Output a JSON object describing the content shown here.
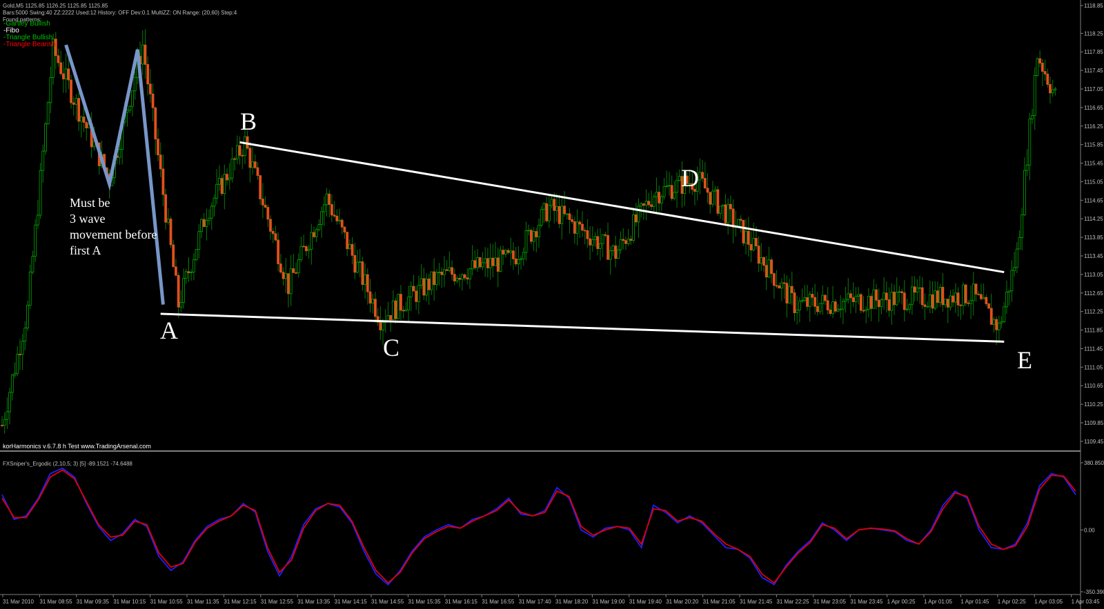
{
  "header": {
    "line1": "Gold,M5  1125.85 1126.25 1125.85 1125.85",
    "line2": "Bars:5000  Swing:40  ZZ:2222  Used:12  History: OFF Dev:0.1  MultiZZ: ON  Range: (20,60)  Step:4",
    "found": "Found patterns:"
  },
  "patterns": [
    {
      "label": "-Gartley Bullish",
      "color": "#00c000"
    },
    {
      "label": "-Fibo",
      "color": "#ffffff"
    },
    {
      "label": "-Triangle Bullish",
      "color": "#00c000"
    },
    {
      "label": "-Triangle Bearish",
      "color": "#ff0000"
    }
  ],
  "annotation": {
    "lines": [
      "Must be",
      "3 wave",
      "movement before",
      "first A"
    ]
  },
  "points": {
    "A": "A",
    "B": "B",
    "C": "C",
    "D": "D",
    "E": "E"
  },
  "watermark": "korHarmonics v.6.7.8 h Test www.TradingArsenal.com",
  "indicator": {
    "title": "FXSniper's_Ergodic (2,10,5; 3) [5] -89.1521 -74.6488"
  },
  "colors": {
    "bull": "#00aa00",
    "bear": "#e0501c",
    "fibo": "#7896c8",
    "line": "#ffffff",
    "ergodic": "#2020ff",
    "signal": "#e00000",
    "axis": "#808080"
  },
  "chart_data": [
    {
      "type": "candlestick",
      "title": "Gold,M5",
      "ylim": [
        1109.3,
        1118.85
      ],
      "y_ticks": [
        "1118.85",
        "1118.25",
        "1117.85",
        "1117.45",
        "1117.05",
        "1116.65",
        "1116.25",
        "1115.85",
        "1115.45",
        "1115.05",
        "1114.65",
        "1114.25",
        "1113.85",
        "1113.45",
        "1113.05",
        "1112.65",
        "1112.25",
        "1111.85",
        "1111.45",
        "1111.05",
        "1110.65",
        "1110.25",
        "1109.85",
        "1109.45"
      ],
      "x_ticks": [
        "31 Mar 2010",
        "31 Mar 08:55",
        "31 Mar 09:35",
        "31 Mar 10:15",
        "31 Mar 10:55",
        "31 Mar 11:35",
        "31 Mar 12:15",
        "31 Mar 12:55",
        "31 Mar 13:35",
        "31 Mar 14:15",
        "31 Mar 14:55",
        "31 Mar 15:35",
        "31 Mar 16:15",
        "31 Mar 16:55",
        "31 Mar 17:40",
        "31 Mar 18:20",
        "31 Mar 19:00",
        "31 Mar 19:40",
        "31 Mar 20:20",
        "31 Mar 21:05",
        "31 Mar 21:45",
        "31 Mar 22:25",
        "31 Mar 23:05",
        "31 Mar 23:45",
        "1 Apr 00:25",
        "1 Apr 01:05",
        "1 Apr 01:45",
        "1 Apr 02:25",
        "1 Apr 03:05",
        "1 Apr 03:45"
      ],
      "path_anchors": [
        {
          "bar": 0,
          "price": 1109.8
        },
        {
          "bar": 10,
          "price": 1112.3
        },
        {
          "bar": 20,
          "price": 1117.9
        },
        {
          "bar": 30,
          "price": 1116.6
        },
        {
          "bar": 42,
          "price": 1115.1
        },
        {
          "bar": 55,
          "price": 1118.0
        },
        {
          "bar": 69,
          "price": 1112.4
        },
        {
          "bar": 80,
          "price": 1114.4
        },
        {
          "bar": 95,
          "price": 1115.9
        },
        {
          "bar": 112,
          "price": 1112.8
        },
        {
          "bar": 127,
          "price": 1114.7
        },
        {
          "bar": 148,
          "price": 1112.1
        },
        {
          "bar": 171,
          "price": 1113.0
        },
        {
          "bar": 200,
          "price": 1113.4
        },
        {
          "bar": 214,
          "price": 1114.5
        },
        {
          "bar": 240,
          "price": 1113.5
        },
        {
          "bar": 255,
          "price": 1114.8
        },
        {
          "bar": 272,
          "price": 1115.1
        },
        {
          "bar": 289,
          "price": 1114.0
        },
        {
          "bar": 310,
          "price": 1112.4
        },
        {
          "bar": 340,
          "price": 1112.5
        },
        {
          "bar": 380,
          "price": 1112.6
        },
        {
          "bar": 390,
          "price": 1111.9
        },
        {
          "bar": 397,
          "price": 1113.5
        },
        {
          "bar": 405,
          "price": 1117.8
        },
        {
          "bar": 412,
          "price": 1116.9
        }
      ],
      "triangle": {
        "A": {
          "bar": 62,
          "price": 1112.2
        },
        "B": {
          "bar": 93,
          "price": 1115.9
        },
        "C": {
          "bar": 148,
          "price": 1112.1
        },
        "D": {
          "bar": 257,
          "price": 1114.9
        },
        "E": {
          "bar": 392,
          "price": 1111.6
        },
        "upper": [
          {
            "bar": 93,
            "price": 1115.9
          },
          {
            "bar": 392,
            "price": 1113.1
          }
        ],
        "lower": [
          {
            "bar": 62,
            "price": 1112.2
          },
          {
            "bar": 392,
            "price": 1111.6
          }
        ]
      },
      "fibo_zigzag": [
        {
          "bar": 25,
          "price": 1118.0
        },
        {
          "bar": 42,
          "price": 1115.0
        },
        {
          "bar": 53,
          "price": 1117.9
        },
        {
          "bar": 63,
          "price": 1112.4
        }
      ]
    },
    {
      "type": "line",
      "title": "FXSniper's_Ergodic (2,10,5; 3) [5] -89.1521 -74.6488",
      "ylim": [
        -350.39,
        380.85
      ],
      "y_ticks": [
        "380.8502",
        "0.00",
        "-350.390"
      ],
      "series": [
        {
          "name": "-89.1521",
          "values": [
            200,
            60,
            80,
            180,
            320,
            350,
            300,
            150,
            20,
            -60,
            -20,
            60,
            20,
            -150,
            -230,
            -180,
            -60,
            20,
            60,
            80,
            150,
            100,
            -120,
            -260,
            -150,
            30,
            120,
            150,
            130,
            40,
            -120,
            -250,
            -310,
            -230,
            -120,
            -40,
            0,
            30,
            10,
            60,
            80,
            120,
            180,
            90,
            80,
            110,
            240,
            180,
            0,
            -40,
            10,
            20,
            0,
            -100,
            140,
            100,
            40,
            80,
            40,
            -30,
            -100,
            -110,
            -160,
            -270,
            -310,
            -200,
            -120,
            -60,
            40,
            0,
            -60,
            0,
            10,
            0,
            -10,
            -60,
            -80,
            0,
            140,
            220,
            180,
            0,
            -100,
            -110,
            -80,
            40,
            250,
            320,
            300,
            200
          ]
        },
        {
          "name": "-74.6488",
          "values": [
            180,
            70,
            70,
            170,
            300,
            340,
            290,
            160,
            30,
            -40,
            -30,
            50,
            30,
            -130,
            -210,
            -190,
            -70,
            10,
            50,
            80,
            140,
            110,
            -100,
            -240,
            -170,
            10,
            110,
            150,
            140,
            50,
            -100,
            -230,
            -300,
            -240,
            -130,
            -50,
            -10,
            20,
            10,
            50,
            80,
            110,
            170,
            100,
            80,
            100,
            220,
            190,
            20,
            -30,
            0,
            20,
            10,
            -80,
            120,
            110,
            50,
            70,
            50,
            -20,
            -80,
            -110,
            -150,
            -250,
            -300,
            -210,
            -130,
            -70,
            30,
            10,
            -50,
            0,
            10,
            5,
            -5,
            -50,
            -80,
            -10,
            120,
            210,
            190,
            20,
            -80,
            -110,
            -90,
            20,
            230,
            310,
            305,
            220
          ]
        }
      ]
    }
  ]
}
